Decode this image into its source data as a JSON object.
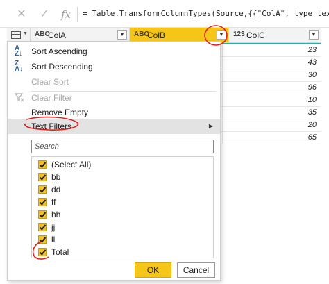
{
  "formula_bar": {
    "cancel_glyph": "✕",
    "commit_glyph": "✓",
    "fx_label": "fx",
    "formula": "= Table.TransformColumnTypes(Source,{{\"ColA\", type text}, {\"C"
  },
  "columns": [
    {
      "type_label": "ABC",
      "name": "ColA"
    },
    {
      "type_label": "ABC",
      "name": "ColB"
    },
    {
      "type_label": "123",
      "name": "ColC"
    }
  ],
  "colc_values": [
    "23",
    "43",
    "30",
    "96",
    "10",
    "35",
    "20",
    "65"
  ],
  "menu": {
    "items": [
      {
        "label": "Sort Ascending",
        "icon": "sort-ascending-icon",
        "enabled": true
      },
      {
        "label": "Sort Descending",
        "icon": "sort-descending-icon",
        "enabled": true
      },
      {
        "label": "Clear Sort",
        "icon": "",
        "enabled": false
      },
      {
        "label": "Clear Filter",
        "icon": "clear-filter-icon",
        "enabled": false
      },
      {
        "label": "Remove Empty",
        "icon": "",
        "enabled": true
      },
      {
        "label": "Text Filters",
        "icon": "",
        "enabled": true,
        "has_submenu": true
      }
    ],
    "search_placeholder": "Search",
    "values": [
      "(Select All)",
      "bb",
      "dd",
      "ff",
      "hh",
      "jj",
      "ll",
      "Total"
    ],
    "ok_label": "OK",
    "cancel_label": "Cancel"
  },
  "colors": {
    "accent": "#f5c518",
    "annotation": "#e11d1d",
    "colc_underline": "#20b2aa"
  }
}
